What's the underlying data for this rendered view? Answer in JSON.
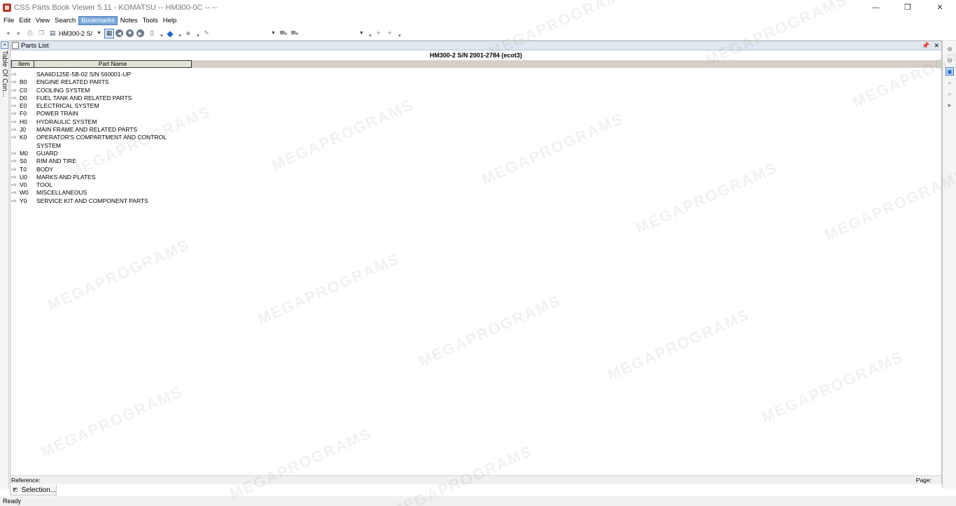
{
  "window": {
    "title": "CSS Parts Book Viewer 5.11 - KOMATSU -- HM300-0C --  --",
    "controls": {
      "minimize": "—",
      "restore": "❐",
      "close": "✕"
    }
  },
  "menu": [
    "File",
    "Edit",
    "View",
    "Search",
    "Bookmarks",
    "Notes",
    "Tools",
    "Help"
  ],
  "menu_active": "Bookmarks",
  "toolbar": {
    "model_combo_value": "HM300-2 S/"
  },
  "left_tab": {
    "label": "Table Of Con..."
  },
  "parts_pane": {
    "title": "Parts List",
    "pin_label": "📌",
    "close_label": "✕",
    "model_header": "HM300-2 S/N 2001-2784 (ecot3)",
    "columns": {
      "item": "Item",
      "part_name": "Part Name"
    },
    "rows": [
      {
        "code": "",
        "name": "SAA6D125E-5B-02 S/N 560001-UP"
      },
      {
        "code": "B0",
        "name": "ENGINE RELATED PARTS"
      },
      {
        "code": "C0",
        "name": "COOLING SYSTEM"
      },
      {
        "code": "D0",
        "name": "FUEL TANK AND RELATED PARTS"
      },
      {
        "code": "E0",
        "name": "ELECTRICAL SYSTEM"
      },
      {
        "code": "F0",
        "name": "POWER TRAIN"
      },
      {
        "code": "H0",
        "name": "HYDRAULIC SYSTEM"
      },
      {
        "code": "J0",
        "name": "MAIN FRAME AND RELATED PARTS"
      },
      {
        "code": "K0",
        "name": "OPERATOR'S COMPARTMENT AND CONTROL"
      },
      {
        "code": "",
        "name": "SYSTEM"
      },
      {
        "code": "M0",
        "name": "GUARD"
      },
      {
        "code": "S0",
        "name": "RIM AND TIRE"
      },
      {
        "code": "T0",
        "name": "BODY"
      },
      {
        "code": "U0",
        "name": "MARKS AND PLATES"
      },
      {
        "code": "V0",
        "name": "TOOL"
      },
      {
        "code": "W0",
        "name": "MISCELLANEOUS"
      },
      {
        "code": "Y0",
        "name": "SERVICE KIT AND COMPONENT PARTS"
      }
    ],
    "reference_label": "Reference:",
    "page_label": "Page:"
  },
  "selection_tab": {
    "label": "Selection..."
  },
  "status": {
    "text": "Ready"
  },
  "watermark": {
    "text": "MEGAPROGRAMS"
  }
}
